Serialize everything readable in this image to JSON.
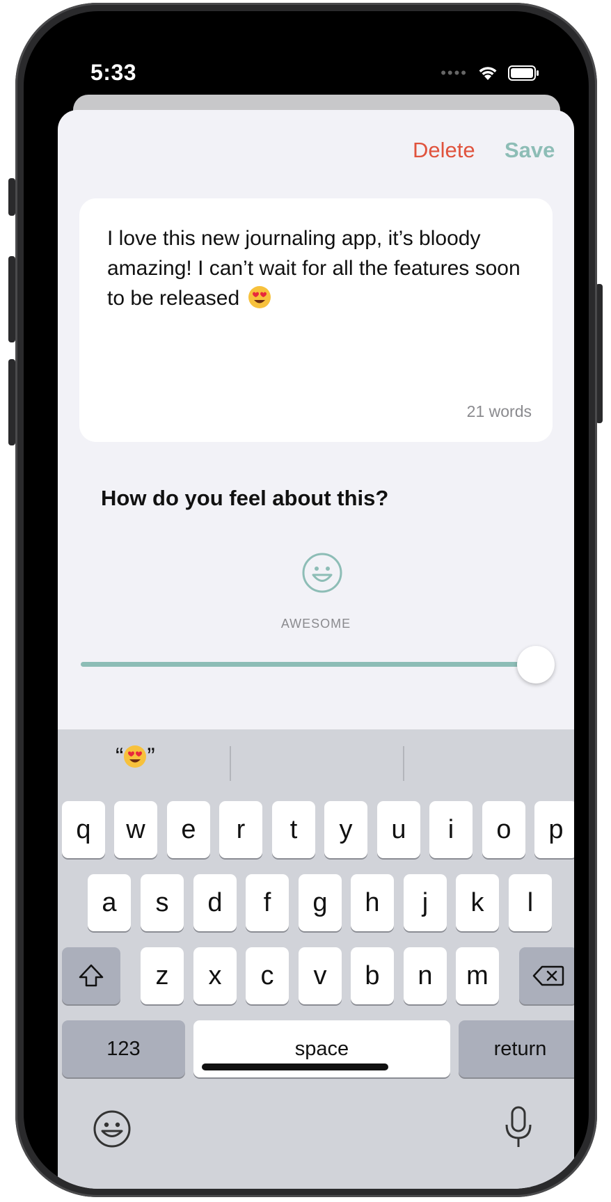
{
  "status_bar": {
    "time": "5:33"
  },
  "nav": {
    "delete_label": "Delete",
    "save_label": "Save"
  },
  "entry": {
    "text": "I love this new journaling app, it’s bloody amazing! I can’t wait for all the features soon to be released",
    "emoji": "heart-eyes-emoji",
    "word_count": "21 words"
  },
  "mood": {
    "question": "How do you feel about this?",
    "label": "AWESOME",
    "icon": "smile-icon",
    "slider_value": 1.0
  },
  "keyboard": {
    "suggestion_left_quote": "“",
    "suggestion_right_quote": "”",
    "row1": [
      "q",
      "w",
      "e",
      "r",
      "t",
      "y",
      "u",
      "i",
      "o",
      "p"
    ],
    "row2": [
      "a",
      "s",
      "d",
      "f",
      "g",
      "h",
      "j",
      "k",
      "l"
    ],
    "row3": [
      "z",
      "x",
      "c",
      "v",
      "b",
      "n",
      "m"
    ],
    "numbers_label": "123",
    "space_label": "space",
    "return_label": "return"
  },
  "colors": {
    "accent": "#8dbdb6",
    "delete": "#e0533d",
    "sheet_bg": "#f2f2f7",
    "keyboard_bg": "#d1d3d9"
  }
}
